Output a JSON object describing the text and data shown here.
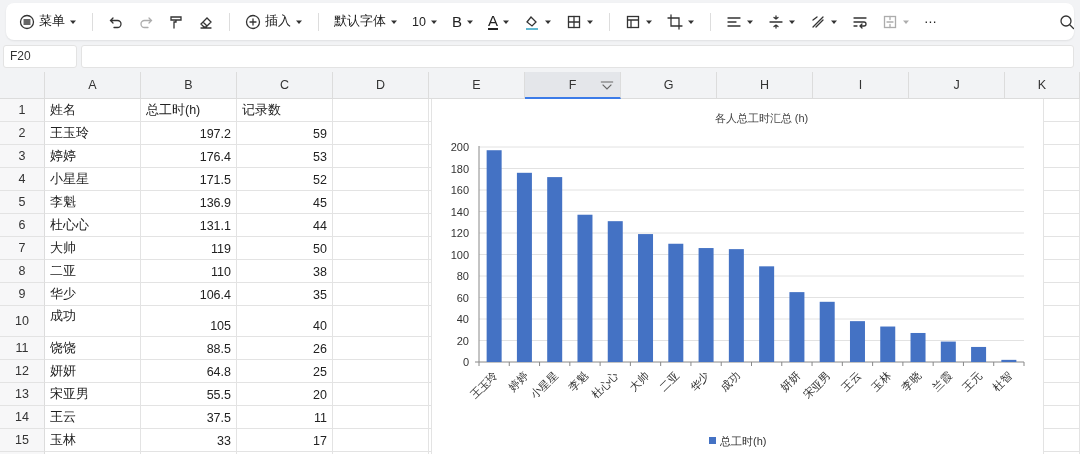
{
  "toolbar": [
    {
      "kind": "menu",
      "label": "菜单",
      "caret": true,
      "disabled": false
    },
    {
      "kind": "sep"
    },
    {
      "kind": "undo",
      "caret": false,
      "disabled": false
    },
    {
      "kind": "redo",
      "caret": false,
      "disabled": true
    },
    {
      "kind": "painter",
      "caret": false,
      "disabled": false
    },
    {
      "kind": "eraser",
      "caret": false,
      "disabled": false
    },
    {
      "kind": "sep"
    },
    {
      "kind": "insert",
      "label": "插入",
      "caret": true,
      "disabled": false
    },
    {
      "kind": "sep"
    },
    {
      "kind": "font",
      "label": "默认字体",
      "caret": true,
      "disabled": false
    },
    {
      "kind": "font",
      "label": "10",
      "caret": true,
      "disabled": false
    },
    {
      "kind": "bold",
      "label": "B",
      "caret": true,
      "disabled": false
    },
    {
      "kind": "color",
      "label": "A",
      "caret": true,
      "disabled": false
    },
    {
      "kind": "fill",
      "caret": true,
      "disabled": false
    },
    {
      "kind": "border",
      "caret": true,
      "disabled": false
    },
    {
      "kind": "sep"
    },
    {
      "kind": "freeze",
      "caret": true,
      "disabled": false
    },
    {
      "kind": "crop",
      "caret": true,
      "disabled": false
    },
    {
      "kind": "sep"
    },
    {
      "kind": "align",
      "caret": true,
      "disabled": false
    },
    {
      "kind": "valign",
      "caret": true,
      "disabled": false
    },
    {
      "kind": "rotate",
      "caret": true,
      "disabled": false
    },
    {
      "kind": "wrap",
      "caret": false,
      "disabled": false
    },
    {
      "kind": "merge",
      "caret": true,
      "disabled": true
    },
    {
      "kind": "more",
      "label": "⋯",
      "caret": false,
      "disabled": false
    },
    {
      "kind": "search",
      "caret": false,
      "disabled": false
    }
  ],
  "name_box": "F20",
  "columns": [
    {
      "label": "A",
      "selected": false
    },
    {
      "label": "B",
      "selected": false
    },
    {
      "label": "C",
      "selected": false
    },
    {
      "label": "D",
      "selected": false
    },
    {
      "label": "E",
      "selected": false
    },
    {
      "label": "F",
      "selected": true,
      "filter": true
    },
    {
      "label": "G",
      "selected": false
    },
    {
      "label": "H",
      "selected": false
    },
    {
      "label": "I",
      "selected": false
    },
    {
      "label": "J",
      "selected": false
    },
    {
      "label": "K",
      "selected": false
    }
  ],
  "rows": [
    {
      "number": "1",
      "kind": "header",
      "cells": [
        "姓名",
        "总工时(h)",
        "记录数"
      ]
    },
    {
      "number": "2",
      "kind": "data",
      "cells": [
        "王玉玲",
        "197.2",
        "59"
      ]
    },
    {
      "number": "3",
      "kind": "data",
      "cells": [
        "婷婷",
        "176.4",
        "53"
      ]
    },
    {
      "number": "4",
      "kind": "data",
      "cells": [
        "小星星",
        "171.5",
        "52"
      ]
    },
    {
      "number": "5",
      "kind": "data",
      "cells": [
        "李魁",
        "136.9",
        "45"
      ]
    },
    {
      "number": "6",
      "kind": "data",
      "cells": [
        "杜心心",
        "131.1",
        "44"
      ]
    },
    {
      "number": "7",
      "kind": "data",
      "cells": [
        "大帅",
        "119",
        "50"
      ]
    },
    {
      "number": "8",
      "kind": "data",
      "cells": [
        "二亚",
        "110",
        "38"
      ]
    },
    {
      "number": "9",
      "kind": "data",
      "cells": [
        "华少",
        "106.4",
        "35"
      ]
    },
    {
      "number": "10",
      "kind": "data",
      "tall": true,
      "cells": [
        "成功",
        "105",
        "40"
      ]
    },
    {
      "number": "11",
      "kind": "data",
      "cells": [
        "饶饶",
        "88.5",
        "26"
      ]
    },
    {
      "number": "12",
      "kind": "data",
      "cells": [
        "妍妍",
        "64.8",
        "25"
      ]
    },
    {
      "number": "13",
      "kind": "data",
      "cells": [
        "宋亚男",
        "55.5",
        "20"
      ]
    },
    {
      "number": "14",
      "kind": "data",
      "cells": [
        "王云",
        "37.5",
        "11"
      ]
    },
    {
      "number": "15",
      "kind": "data",
      "cells": [
        "玉林",
        "33",
        "17"
      ]
    }
  ],
  "chart": {
    "chart_data": {
      "type": "bar",
      "title": "各人总工时汇总 (h)",
      "categories": [
        "王玉玲",
        "婷婷",
        "小星星",
        "李魁",
        "杜心心",
        "大帅",
        "二亚",
        "华少",
        "成功",
        null,
        "妍妍",
        "宋亚男",
        "王云",
        "玉林",
        "李晓",
        "兰霞",
        "王元",
        "杜智"
      ],
      "series": [
        {
          "name": "总工时(h)",
          "color": "#4472c4",
          "values": [
            197,
            176,
            172,
            137,
            131,
            119,
            110,
            106,
            105,
            89,
            65,
            56,
            38,
            33,
            27,
            19,
            14,
            2
          ]
        }
      ],
      "grid": true,
      "ylim": [
        0,
        200
      ],
      "yticks": [
        0,
        20,
        40,
        60,
        80,
        100,
        120,
        140,
        160,
        180,
        200
      ]
    }
  }
}
